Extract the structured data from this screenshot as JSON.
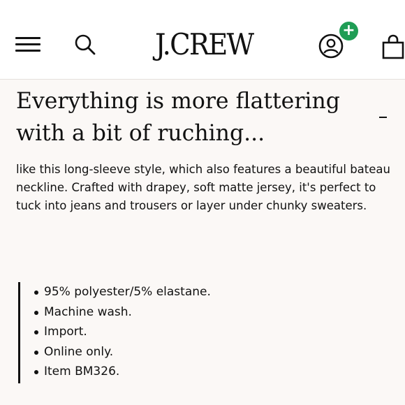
{
  "header": {
    "logo": "J.CREW",
    "account_badge": "+",
    "icons": {
      "menu": "hamburger-menu-icon",
      "search": "search-icon",
      "account": "user-account-icon",
      "bag": "shopping-bag-icon"
    },
    "colors": {
      "badge": "#1f9d55",
      "background": "#ffffff"
    }
  },
  "product": {
    "title": "Everything is more flattering with a bit of ruching...",
    "collapse_symbol": "-",
    "description": "like this long-sleeve style, which also features a beautiful bateau neckline. Crafted with drapey, soft matte jersey, it's perfect to tuck into jeans and trousers or layer under chunky sweaters.",
    "details": [
      "95% polyester/5% elastane.",
      "Machine wash.",
      "Import.",
      "Online only.",
      "Item BM326."
    ]
  },
  "colors": {
    "page_background": "#fbf8f6",
    "text": "#111111"
  }
}
